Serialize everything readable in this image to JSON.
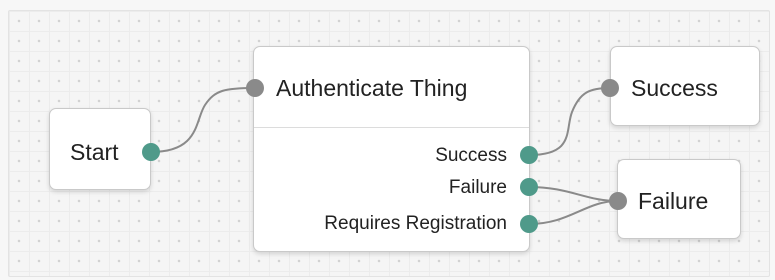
{
  "colors": {
    "input_port": "#8a8a8a",
    "output_port": "#4f9a8a",
    "wire": "#8a8a8a"
  },
  "nodes": {
    "start": {
      "title": "Start"
    },
    "authenticate": {
      "title": "Authenticate Thing",
      "outcomes": [
        "Success",
        "Failure",
        "Requires Registration"
      ]
    },
    "success": {
      "title": "Success"
    },
    "failure": {
      "title": "Failure"
    }
  }
}
